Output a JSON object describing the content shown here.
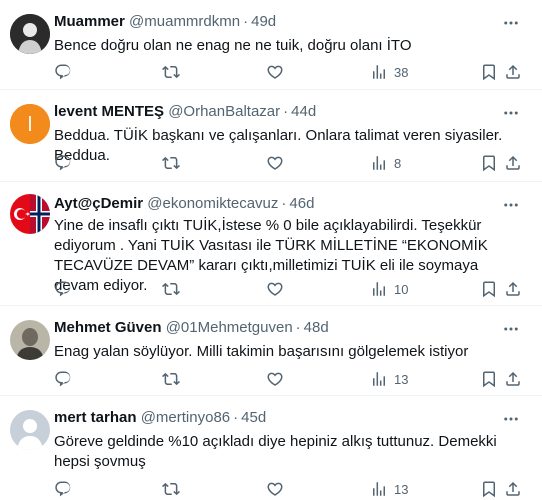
{
  "tweets": [
    {
      "name": "Muammer",
      "handle": "@muammrdkmn",
      "time": "49d",
      "text": "Bence doğru olan ne enag ne ne tuik, doğru olanı İTO",
      "views": "38",
      "avatar_color": "#2b2b2b",
      "avatar_letter": ""
    },
    {
      "name": "levent MENTEŞ",
      "handle": "@OrhanBaltazar",
      "time": "44d",
      "text": "Beddua. TÜİK başkanı ve çalışanları. Onlara talimat veren siyasiler. Beddua.",
      "views": "8",
      "avatar_color": "#f28a1c",
      "avatar_letter": "l"
    },
    {
      "name": "Ayt@çDemir",
      "handle": "@ekonomiktecavuz",
      "time": "46d",
      "text": "Yine de insaflı çıktı TUİK,İstese % 0 bile açıklayabilirdi. Teşekkür ediyorum . Yani TUİK Vasıtası ile TÜRK MİLLETİNE “EKONOMİK TECAVÜZE DEVAM” kararı çıktı,milletimizi TUİK eli ile soymaya devam ediyor.",
      "views": "10",
      "avatar_color": "#e30a17",
      "avatar_letter": ""
    },
    {
      "name": "Mehmet Güven",
      "handle": "@01Mehmetguven",
      "time": "48d",
      "text": "Enag yalan söylüyor. Milli takimin başarısını gölgelemek istiyor",
      "views": "13",
      "avatar_color": "#8a8a80",
      "avatar_letter": ""
    },
    {
      "name": "mert tarhan",
      "handle": "@mertinyo86",
      "time": "45d",
      "text": "Göreve geldinde %10 açıkladı diye hepiniz alkış tuttunuz. Demekki hepsi şovmuş",
      "views": "13",
      "avatar_color": "#c7d0d8",
      "avatar_letter": ""
    }
  ]
}
